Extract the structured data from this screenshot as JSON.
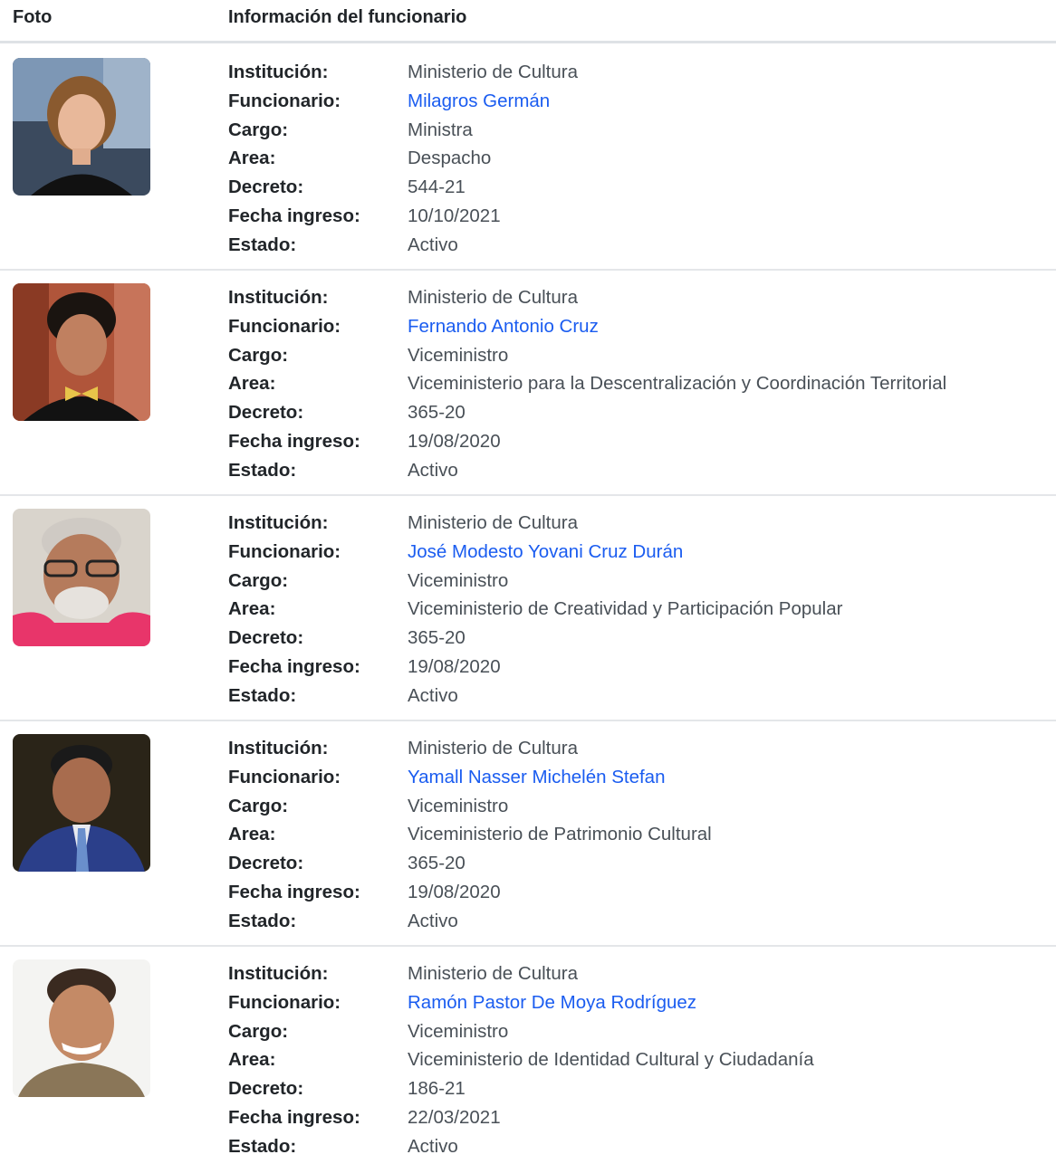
{
  "header": {
    "photo_col": "Foto",
    "info_col": "Información del funcionario"
  },
  "labels": {
    "institucion": "Institución:",
    "funcionario": "Funcionario:",
    "cargo": "Cargo:",
    "area": "Area:",
    "decreto": "Decreto:",
    "fecha": "Fecha ingreso:",
    "estado": "Estado:"
  },
  "colors": {
    "link": "#1a5cf0",
    "text": "#495057",
    "label": "#212529",
    "divider": "#e4e6e9"
  },
  "officials": [
    {
      "institucion": "Ministerio de Cultura",
      "funcionario": "Milagros Germán",
      "cargo": "Ministra",
      "area": "Despacho",
      "decreto": "544-21",
      "fecha": "10/10/2021",
      "estado": "Activo"
    },
    {
      "institucion": "Ministerio de Cultura",
      "funcionario": "Fernando Antonio Cruz",
      "cargo": "Viceministro",
      "area": "Viceministerio para la Descentralización y Coordinación Territorial",
      "decreto": "365-20",
      "fecha": "19/08/2020",
      "estado": "Activo"
    },
    {
      "institucion": "Ministerio de Cultura",
      "funcionario": "José Modesto Yovani Cruz Durán",
      "cargo": "Viceministro",
      "area": "Viceministerio de Creatividad y Participación Popular",
      "decreto": "365-20",
      "fecha": "19/08/2020",
      "estado": "Activo"
    },
    {
      "institucion": "Ministerio de Cultura",
      "funcionario": "Yamall Nasser Michelén Stefan",
      "cargo": "Viceministro",
      "area": "Viceministerio de Patrimonio Cultural",
      "decreto": "365-20",
      "fecha": "19/08/2020",
      "estado": "Activo"
    },
    {
      "institucion": "Ministerio de Cultura",
      "funcionario": "Ramón Pastor De Moya Rodríguez",
      "cargo": "Viceministro",
      "area": "Viceministerio de Identidad Cultural y Ciudadanía",
      "decreto": "186-21",
      "fecha": "22/03/2021",
      "estado": "Activo"
    }
  ]
}
